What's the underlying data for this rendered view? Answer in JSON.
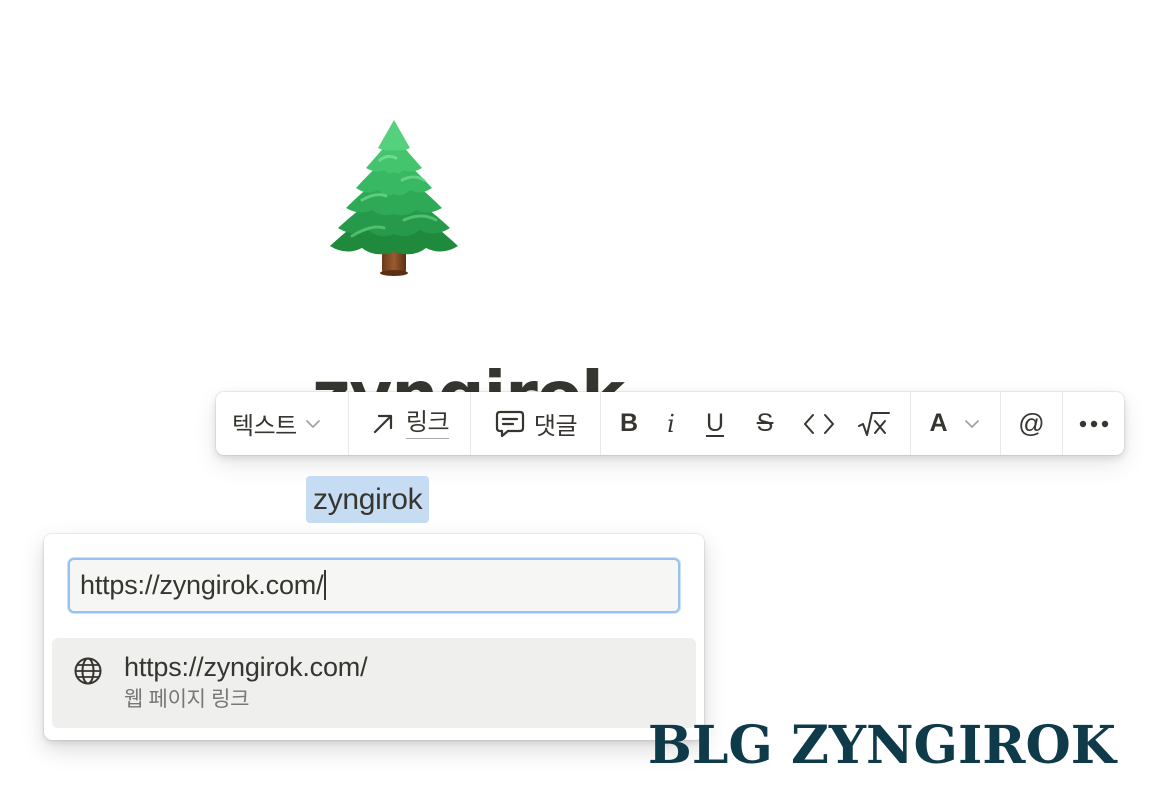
{
  "page": {
    "icon": "evergreen-tree-emoji",
    "title": "zyngirok"
  },
  "toolbar": {
    "text_type_label": "텍스트",
    "link_label": "링크",
    "comment_label": "댓글",
    "bold_label": "B",
    "italic_label": "i",
    "underline_label": "U",
    "strike_label": "S",
    "code_label": "<>",
    "equation_label": "√x",
    "color_label": "A",
    "mention_label": "@",
    "more_label": "•••"
  },
  "selection": {
    "text": "zyngirok",
    "highlight_color": "#c6dcf2"
  },
  "link_popover": {
    "input_value": "https://zyngirok.com/",
    "suggestion": {
      "icon": "globe-icon",
      "url": "https://zyngirok.com/",
      "subtitle": "웹 페이지 링크"
    }
  },
  "watermark": {
    "text": "BLG ZYNGIROK",
    "color": "#0f3a4a"
  },
  "colors": {
    "text": "#37352f",
    "input_focus_border": "#97c2ef",
    "suggestion_bg": "#efefee"
  }
}
